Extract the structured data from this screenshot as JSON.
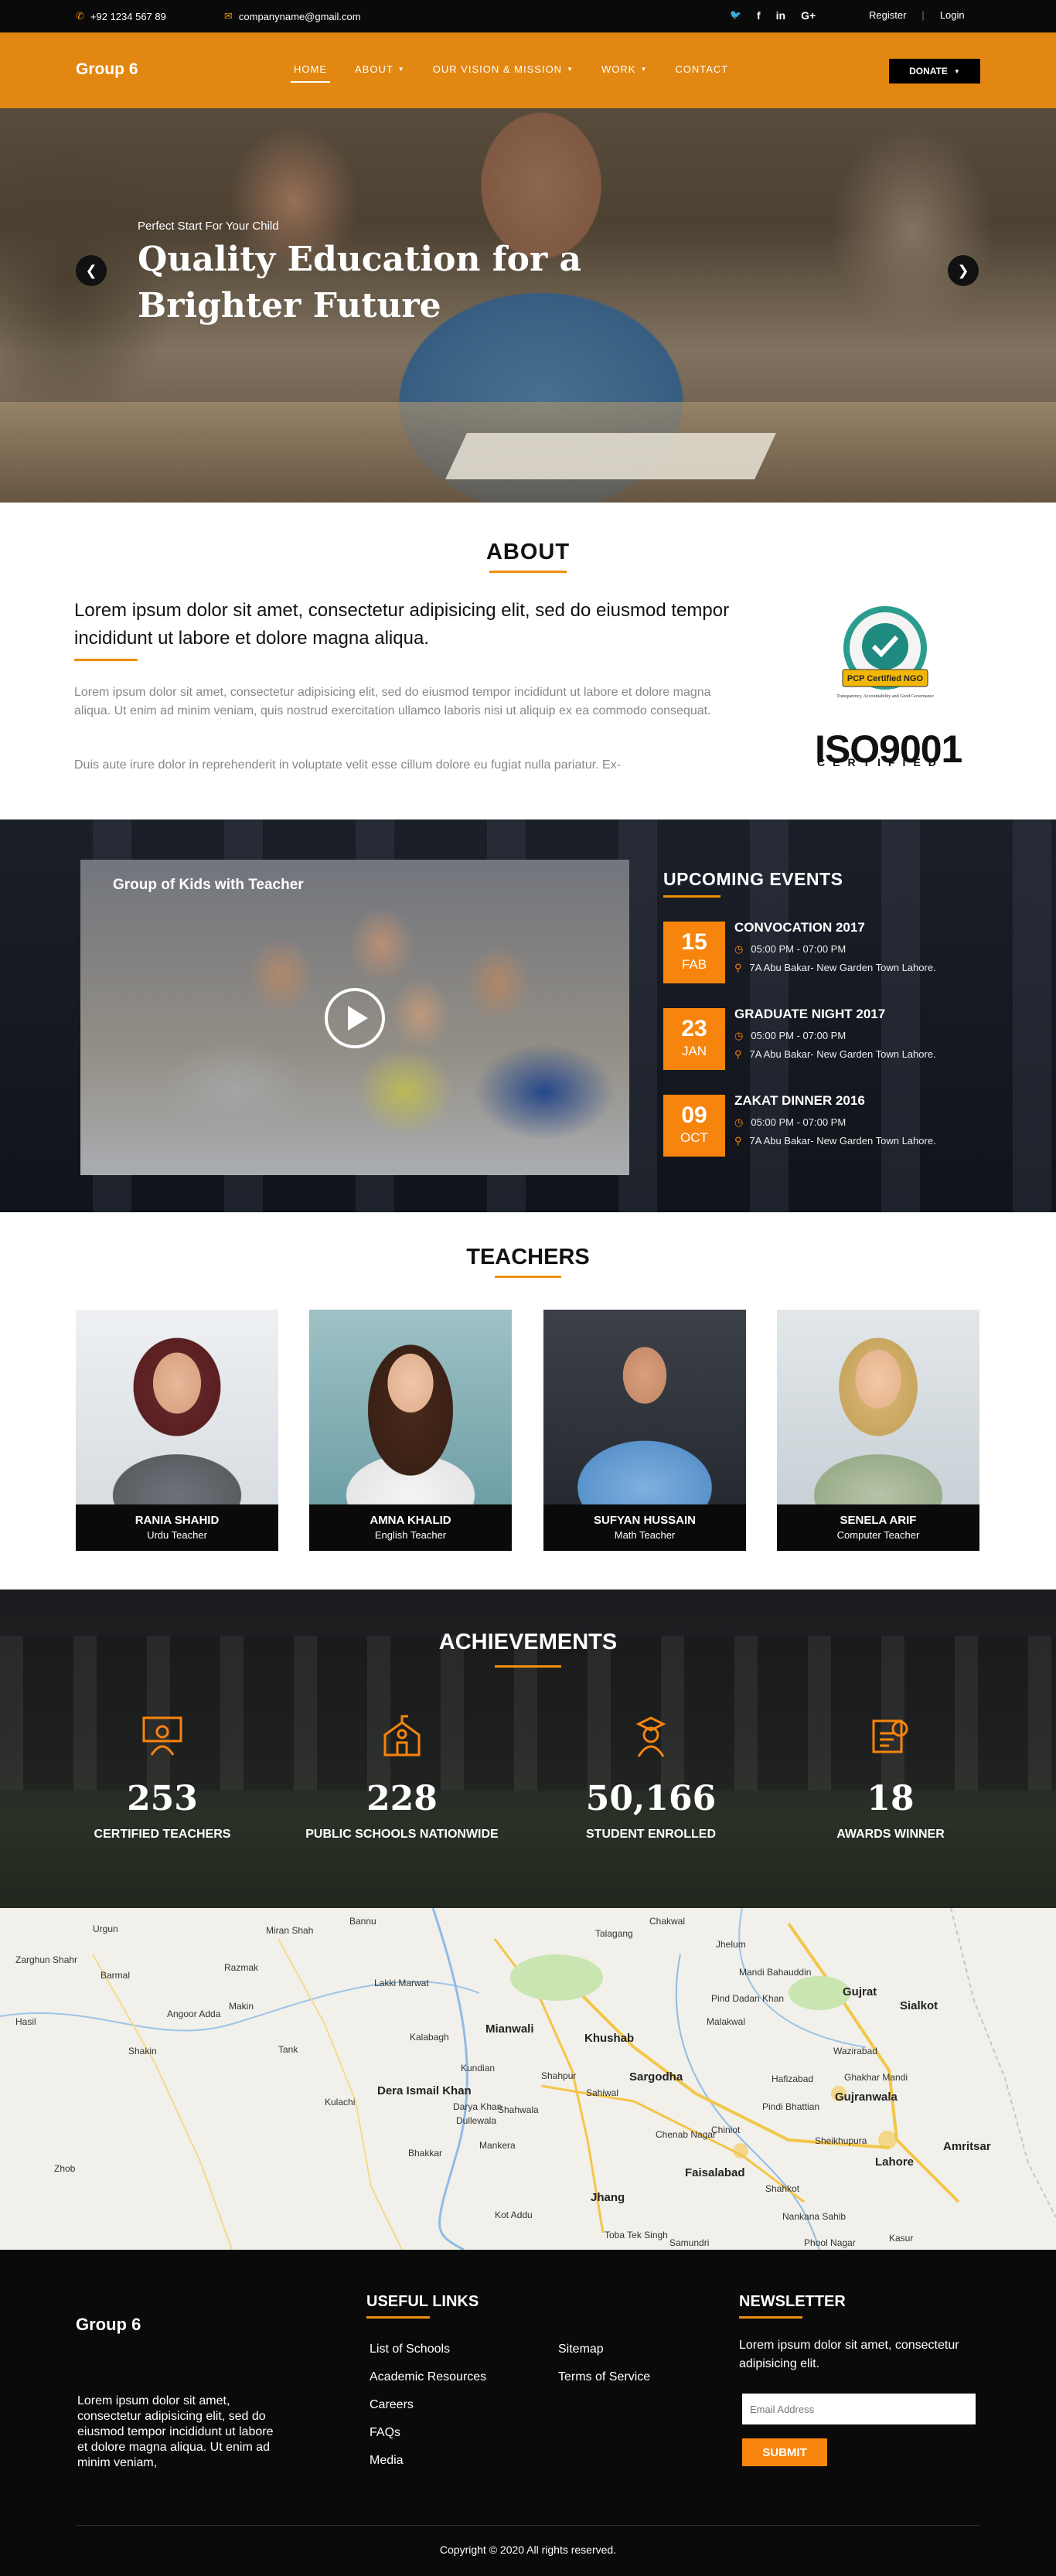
{
  "topbar": {
    "phone": "+92 1234 567 89",
    "email": "companyname@gmail.com",
    "social": [
      "twitter-icon",
      "facebook-icon",
      "linkedin-icon",
      "google-plus-icon"
    ],
    "social_glyphs": [
      "🐦",
      "f",
      "in",
      "G+"
    ],
    "register": "Register",
    "separator": "|",
    "login": "Login"
  },
  "nav": {
    "logo": "Group 6",
    "items": [
      {
        "label": "HOME",
        "dropdown": false
      },
      {
        "label": "ABOUT",
        "dropdown": true
      },
      {
        "label": "OUR VISION & MISSION",
        "dropdown": true
      },
      {
        "label": "WORK",
        "dropdown": true
      },
      {
        "label": "CONTACT",
        "dropdown": false
      }
    ],
    "donate": "DONATE"
  },
  "hero": {
    "kicker": "Perfect Start For Your Child",
    "title": "Quality Education for a Brighter Future"
  },
  "about": {
    "title": "ABOUT",
    "lead": "Lorem ipsum dolor sit amet, consectetur adipisicing elit, sed do eiusmod tempor incididunt ut labore et dolore magna aliqua.",
    "p1": "Lorem ipsum dolor sit amet, consectetur adipisicing elit, sed do eiusmod tempor incididunt ut labore et dolore magna aliqua. Ut enim ad minim veniam, quis nostrud exercitation ullamco laboris nisi ut aliquip ex ea commodo consequat.",
    "p2": "Duis aute irure dolor in reprehenderit in voluptate velit esse cillum dolore eu fugiat nulla pariatur. Ex-",
    "badge_text": "PCP Certified NGO",
    "badge_sub": "Transparency, Accountability and Good Governance",
    "iso": "ISO9001",
    "iso_sub": "CERTIFIED"
  },
  "events": {
    "video_title": "Group of Kids with Teacher",
    "heading": "UPCOMING EVENTS",
    "list": [
      {
        "day": "15",
        "month": "FAB",
        "title": "CONVOCATION 2017",
        "time": "05:00 PM - 07:00 PM",
        "place": "7A Abu Bakar- New Garden Town Lahore."
      },
      {
        "day": "23",
        "month": "JAN",
        "title": "GRADUATE NIGHT 2017",
        "time": "05:00 PM - 07:00 PM",
        "place": "7A Abu Bakar- New Garden Town Lahore."
      },
      {
        "day": "09",
        "month": "OCT",
        "title": "ZAKAT DINNER 2016",
        "time": "05:00 PM - 07:00 PM",
        "place": "7A Abu Bakar- New Garden Town Lahore."
      }
    ]
  },
  "teachers": {
    "title": "TEACHERS",
    "list": [
      {
        "name": "RANIA SHAHID",
        "role": "Urdu Teacher"
      },
      {
        "name": "AMNA KHALID",
        "role": "English Teacher"
      },
      {
        "name": "SUFYAN HUSSAIN",
        "role": "Math Teacher"
      },
      {
        "name": "SENELA ARIF",
        "role": "Computer Teacher"
      }
    ]
  },
  "achievements": {
    "title": "ACHIEVEMENTS",
    "stats": [
      {
        "value": "253",
        "label": "CERTIFIED TEACHERS",
        "icon": "teacher-board-icon"
      },
      {
        "value": "228",
        "label": "PUBLIC SCHOOLS NATIONWIDE",
        "icon": "school-building-icon"
      },
      {
        "value": "50,166",
        "label": "STUDENT ENROLLED",
        "icon": "student-icon"
      },
      {
        "value": "18",
        "label": "AWARDS WINNER",
        "icon": "award-certificate-icon"
      }
    ]
  },
  "map": {
    "labels": [
      "Zarghun Shahr",
      "Urgun",
      "Miran Shah",
      "Bannu",
      "Talagang",
      "Chakwal",
      "Jhelum",
      "Mandi Bahauddin",
      "Gujrat",
      "Sialkot",
      "Barmal",
      "Razmak",
      "Lakki Marwat",
      "Khushab",
      "Malakwal",
      "Wazirabad",
      "Angoor Adda",
      "Makin",
      "Mianwali",
      "Sargodha",
      "Hafizabad",
      "Gujranwala",
      "Hasil",
      "Shakin",
      "Kalabagh",
      "Shahpur",
      "Chiniot",
      "Sheikhupura",
      "Amritsar",
      "Dera Ismail Khan",
      "Kulachi",
      "Bhakkar",
      "Jhang",
      "Chenab Nagar",
      "Faisalabad",
      "Lahore",
      "Kasur",
      "Toba Tek Singh",
      "Samundri",
      "Phool Nagar",
      "Mankera",
      "Kot Addu",
      "Zhob",
      "Darya Khan",
      "Pind Dadan Khan",
      "Shahkot",
      "Nankana Sahib",
      "Kundian",
      "Dullewala",
      "Shahwala",
      "Sahiwal",
      "Ghakhar Mandi",
      "Pindi Bhattian",
      "Tank"
    ]
  },
  "footer": {
    "logo": "Group 6",
    "about": "Lorem ipsum dolor sit amet, consectetur adipisicing elit, sed do eiusmod tempor incididunt ut labore et dolore magna aliqua. Ut enim ad minim veniam,",
    "links_heading": "USEFUL LINKS",
    "links_col1": [
      "List of Schools",
      "Academic Resources",
      "Careers",
      "FAQs",
      "Media"
    ],
    "links_col2": [
      "Sitemap",
      "Terms of Service"
    ],
    "newsletter_heading": "NEWSLETTER",
    "newsletter_text": "Lorem ipsum dolor sit amet, consectetur adipisicing elit.",
    "email_placeholder": "Email Address",
    "submit": "SUBMIT",
    "copyright": "Copyright © 2020 All rights reserved."
  },
  "colors": {
    "accent": "#f0900b",
    "dark": "#0a0a0a"
  }
}
